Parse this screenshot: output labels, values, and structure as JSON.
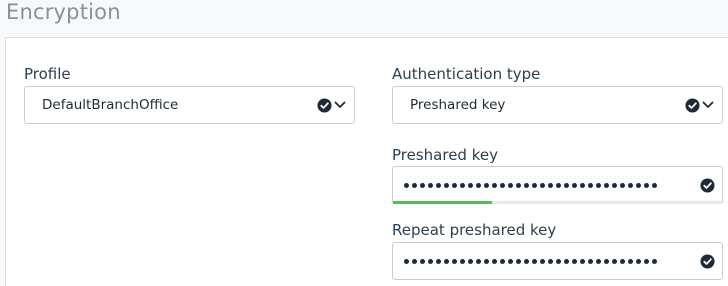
{
  "section": {
    "title": "Encryption"
  },
  "profile": {
    "label": "Profile",
    "value": "DefaultBranchOffice",
    "valid_icon": "check-circle-icon",
    "dropdown_icon": "chevron-down-icon"
  },
  "auth_type": {
    "label": "Authentication type",
    "value": "Preshared key",
    "valid_icon": "check-circle-icon",
    "dropdown_icon": "chevron-down-icon"
  },
  "preshared_key": {
    "label": "Preshared key",
    "masked_length": 32,
    "valid_icon": "check-circle-icon",
    "strength_fraction": 0.3,
    "strength_color": "#5cb85c"
  },
  "repeat_key": {
    "label": "Repeat preshared key",
    "masked_length": 32,
    "valid_icon": "check-circle-icon"
  },
  "colors": {
    "text": "#2c3e50",
    "border": "#c8ccd1",
    "icon": "#1e2a38",
    "accent_green": "#5cb85c"
  }
}
